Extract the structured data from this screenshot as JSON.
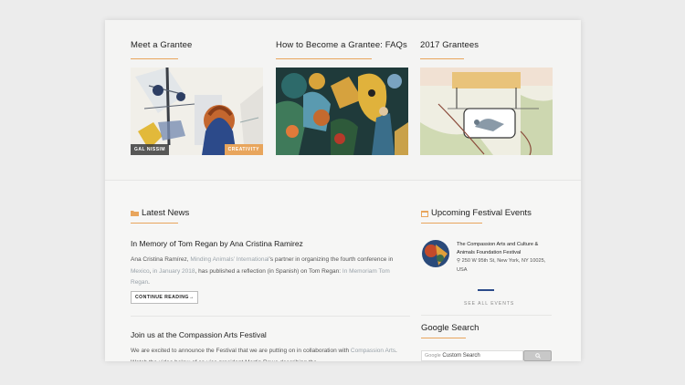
{
  "top": {
    "columns": [
      {
        "title": "Meet a Grantee",
        "tag_left": "GAL NISSIM",
        "tag_right": "CREATIVITY"
      },
      {
        "title": "How to Become a Grantee: FAQs"
      },
      {
        "title": "2017 Grantees"
      }
    ]
  },
  "news": {
    "heading": "Latest News",
    "post1": {
      "title": "In Memory of Tom Regan by Ana Cristina Ramirez",
      "t1": "Ana Cristina Ramírez, ",
      "l1": "Minding Animals’ International",
      "t2": "’s partner in organizing the fourth conference in ",
      "l2": "Mexico",
      "t3": ", ",
      "l3": "in January 2018",
      "t4": ", has published a reflection (in Spanish) on Tom Regan: ",
      "l4": "In Memoriam Tom Regan",
      "t5": ".",
      "button": "CONTINUE READING→"
    },
    "post2": {
      "title": "Join us at the Compassion Arts Festival",
      "t1": "We are excited to announce the Festival that we are putting on in collaboration with ",
      "l1": "Compassion Arts",
      "t2": ". Watch the video below of co-vice president Martin Rowe describing the"
    }
  },
  "events": {
    "heading": "Upcoming Festival Events",
    "title": "The Compassion Arts and Culture & Animals Foundation Festival",
    "address": "250 W 95th St, New York, NY 10025, USA",
    "see_all": "SEE ALL EVENTS"
  },
  "search": {
    "heading": "Google Search",
    "placeholder": "Custom Search",
    "brand": "Google"
  },
  "colors": {
    "accent": "#e8a55c",
    "link": "#9aa3aa",
    "blue_line": "#2b4a8a"
  }
}
